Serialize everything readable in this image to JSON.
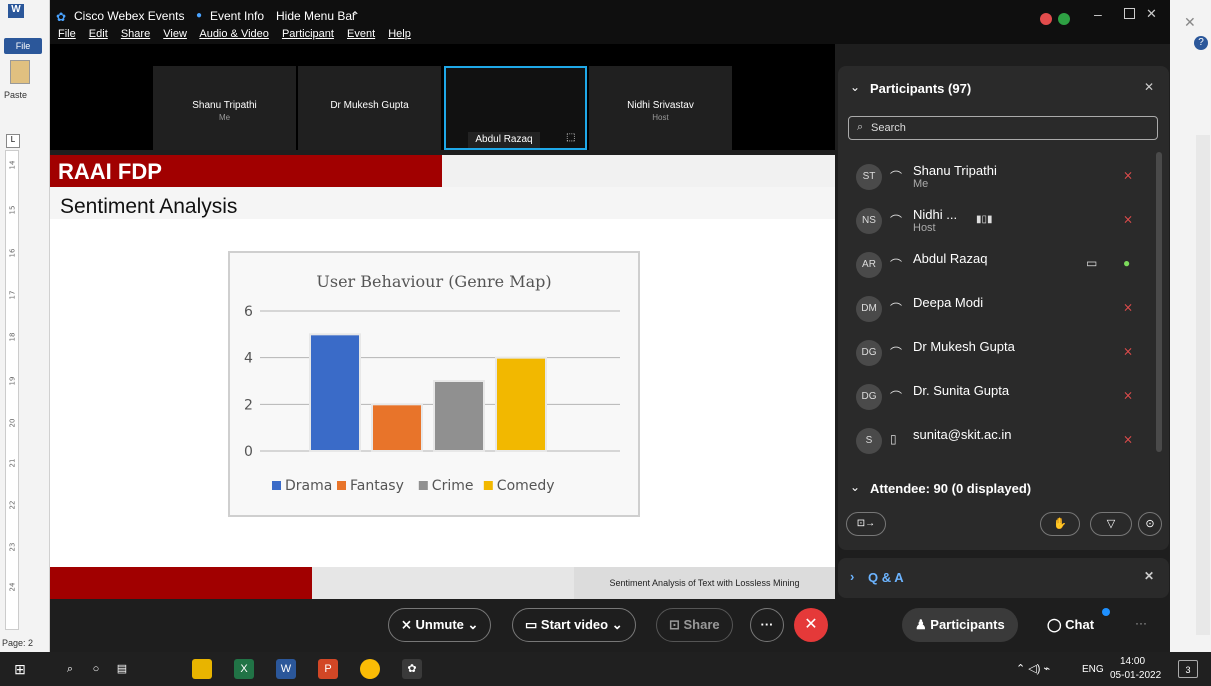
{
  "word": {
    "file_tab": "File",
    "paste_label": "Paste",
    "page_label": "Page: 2",
    "ruler_marks": [
      "14",
      "15",
      "16",
      "17",
      "18",
      "19",
      "20",
      "21",
      "22",
      "23",
      "24"
    ]
  },
  "webex": {
    "app_name": "Cisco Webex Events",
    "event_info": "Event Info",
    "hide_menu": "Hide Menu Bar",
    "menu": [
      "File",
      "Edit",
      "Share",
      "View",
      "Audio & Video",
      "Participant",
      "Event",
      "Help"
    ]
  },
  "video_tiles": [
    {
      "name": "Shanu Tripathi",
      "sub": "Me"
    },
    {
      "name": "Dr Mukesh Gupta",
      "sub": ""
    },
    {
      "name": "Abdul Razaq",
      "sub": ""
    },
    {
      "name": "Nidhi Srivastav",
      "sub": "Host"
    }
  ],
  "slide": {
    "title": "RAAI FDP",
    "subtitle": "Sentiment Analysis",
    "footer": "Sentiment Analysis of Text with Lossless Mining"
  },
  "chart_data": {
    "type": "bar",
    "title": "User Behaviour (Genre Map)",
    "categories": [
      "Drama",
      "Fantasy",
      "Crime",
      "Comedy"
    ],
    "values": [
      5,
      2,
      3,
      4
    ],
    "ylim": [
      0,
      6
    ],
    "yticks": [
      "0",
      "2",
      "4",
      "6"
    ],
    "colors": [
      "#3a6bc8",
      "#e8742a",
      "#909090",
      "#f2b800"
    ],
    "legend": "bottom",
    "grid": true
  },
  "participants": {
    "title": "Participants (97)",
    "search_placeholder": "Search",
    "list": [
      {
        "initials": "ST",
        "name": "Shanu Tripathi",
        "sub": "Me"
      },
      {
        "initials": "NS",
        "name": "Nidhi ...",
        "sub": "Host"
      },
      {
        "initials": "AR",
        "name": "Abdul Razaq",
        "sub": ""
      },
      {
        "initials": "DM",
        "name": "Deepa Modi",
        "sub": ""
      },
      {
        "initials": "DG",
        "name": "Dr Mukesh Gupta",
        "sub": ""
      },
      {
        "initials": "DG",
        "name": "Dr. Sunita Gupta",
        "sub": ""
      },
      {
        "initials": "S",
        "name": "sunita@skit.ac.in",
        "sub": ""
      }
    ],
    "attendee": "Attendee: 90 (0 displayed)",
    "qa": "Q & A"
  },
  "controls": {
    "unmute": "Unmute",
    "start_video": "Start video",
    "share": "Share",
    "participants": "Participants",
    "chat": "Chat"
  },
  "taskbar": {
    "lang": "ENG",
    "time": "14:00",
    "date": "05-01-2022",
    "notif": "3"
  }
}
